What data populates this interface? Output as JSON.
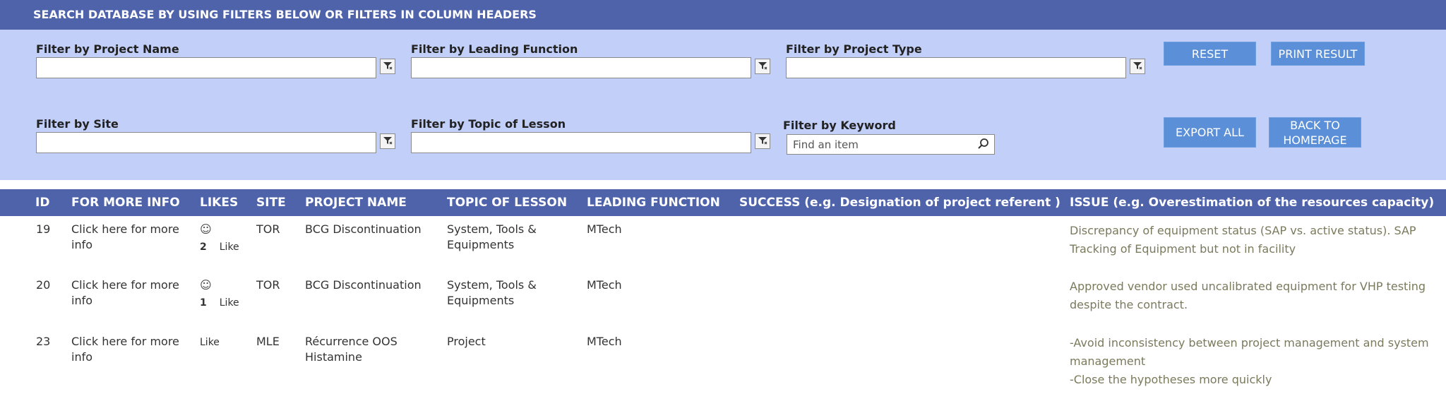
{
  "header": {
    "title": "SEARCH DATABASE BY USING FILTERS BELOW OR FILTERS IN COLUMN HEADERS"
  },
  "filters": {
    "project_name": {
      "label": "Filter by Project Name",
      "value": ""
    },
    "leading_function": {
      "label": "Filter by Leading Function",
      "value": ""
    },
    "project_type": {
      "label": "Filter by Project Type",
      "value": ""
    },
    "site": {
      "label": "Filter by Site",
      "value": ""
    },
    "topic_of_lesson": {
      "label": "Filter by Topic of Lesson",
      "value": ""
    },
    "keyword": {
      "label": "Filter by Keyword",
      "placeholder": "Find an item"
    }
  },
  "buttons": {
    "reset": "RESET",
    "print_result": "PRINT RESULT",
    "export_all": "EXPORT ALL",
    "back_line1": "BACK TO",
    "back_line2": "HOMEPAGE"
  },
  "table": {
    "columns": {
      "id": "ID",
      "more_info": "FOR MORE INFO",
      "likes": "LIKES",
      "site": "SITE",
      "project_name": "PROJECT NAME",
      "topic": "TOPIC OF LESSON",
      "leading_function": "LEADING FUNCTION",
      "success": "SUCCESS (e.g. Designation of project referent )",
      "issue": "ISSUE (e.g. Overestimation of the resources capacity)"
    },
    "rows": [
      {
        "id": "19",
        "more_info": "Click here for more info",
        "like_face": "☺",
        "like_count": "2",
        "like_label": "Like",
        "site": "TOR",
        "project_name": "BCG Discontinuation",
        "topic": "System, Tools & Equipments",
        "leading_function": "MTech",
        "success": "",
        "issue": "Discrepancy of equipment status (SAP vs. active status). SAP Tracking of Equipment but not in facility"
      },
      {
        "id": "20",
        "more_info": "Click here for more info",
        "like_face": "☺",
        "like_count": "1",
        "like_label": "Like",
        "site": "TOR",
        "project_name": "BCG Discontinuation",
        "topic": "System, Tools & Equipments",
        "leading_function": "MTech",
        "success": "",
        "issue": "Approved vendor used uncalibrated equipment for VHP testing despite the contract."
      },
      {
        "id": "23",
        "more_info": "Click here for more info",
        "like_label": "Like",
        "site": "MLE",
        "project_name": "Récurrence OOS Histamine",
        "topic": "Project",
        "leading_function": "MTech",
        "success": "",
        "issue_line1": "-Avoid inconsistency between project management and system management",
        "issue_line2": "-Close the hypotheses more quickly"
      }
    ]
  },
  "icons": {
    "filter": "filter-funnel-icon",
    "search": "magnifier-search-icon"
  },
  "colors": {
    "header_bar": "#4f63ab",
    "filter_panel": "#c2cff9",
    "button": "#5b8fd8",
    "issue_text": "#7a7a5c"
  }
}
